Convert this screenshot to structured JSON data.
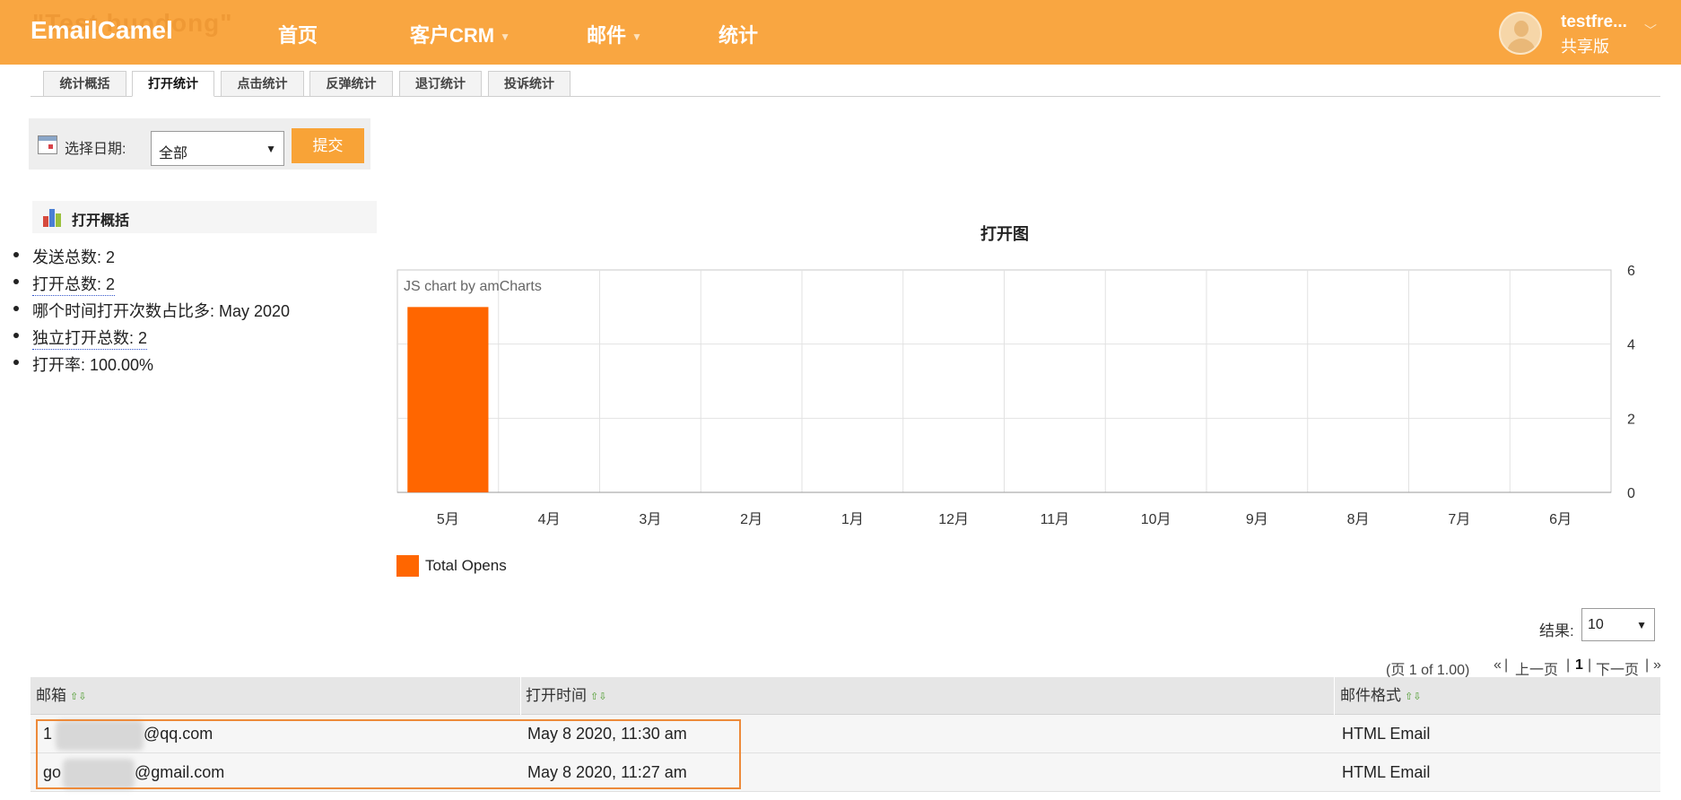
{
  "header": {
    "ghost_title": "\"Test huodong\"",
    "logo": "EmailCamel",
    "nav": [
      {
        "label": "首页",
        "has_dropdown": false
      },
      {
        "label": "客户CRM",
        "has_dropdown": true
      },
      {
        "label": "邮件",
        "has_dropdown": true
      },
      {
        "label": "统计",
        "has_dropdown": false
      }
    ],
    "user": {
      "name": "testfre...",
      "plan": "共享版"
    }
  },
  "tabs": [
    "统计概括",
    "打开统计",
    "点击统计",
    "反弹统计",
    "退订统计",
    "投诉统计"
  ],
  "active_tab": "打开统计",
  "date_filter": {
    "label": "选择日期:",
    "selected": "全部",
    "submit_label": "提交"
  },
  "summary": {
    "title": "打开概括",
    "items": [
      "发送总数: 2",
      "打开总数: 2",
      "哪个时间打开次数占比多: May 2020",
      "独立打开总数: 2",
      "打开率: 100.00%"
    ]
  },
  "chart_data": {
    "type": "bar",
    "title": "打开图",
    "credit": "JS chart by amCharts",
    "categories": [
      "5月",
      "4月",
      "3月",
      "2月",
      "1月",
      "12月",
      "11月",
      "10月",
      "9月",
      "8月",
      "7月",
      "6月"
    ],
    "series": [
      {
        "name": "Total Opens",
        "color": "#ff6600",
        "values": [
          5,
          0,
          0,
          0,
          0,
          0,
          0,
          0,
          0,
          0,
          0,
          0
        ]
      }
    ],
    "y_ticks": [
      "6",
      "4",
      "2",
      "0"
    ],
    "ylim": [
      0,
      6
    ],
    "y_axis_position": "right",
    "grid": true,
    "legend_position": "bottom-left"
  },
  "results": {
    "label": "结果:",
    "per_page": "10"
  },
  "pagination": {
    "info": "(页 1 of 1.00)",
    "first": "«",
    "prev": "上一页",
    "current": "1",
    "next": "下一页",
    "last": "»",
    "sep": "|"
  },
  "table": {
    "columns": [
      "邮箱",
      "打开时间",
      "邮件格式"
    ],
    "rows": [
      {
        "email_prefix": "1",
        "email_suffix": "@qq.com",
        "time": "May 8 2020, 11:30 am",
        "format": "HTML Email"
      },
      {
        "email_prefix": "go",
        "email_suffix": "@gmail.com",
        "time": "May 8 2020, 11:27 am",
        "format": "HTML Email"
      }
    ]
  },
  "colors": {
    "brand": "#f9a641",
    "accent_button": "#f8a337",
    "bar": "#ff6600",
    "highlight_border": "#ed8a3a"
  }
}
